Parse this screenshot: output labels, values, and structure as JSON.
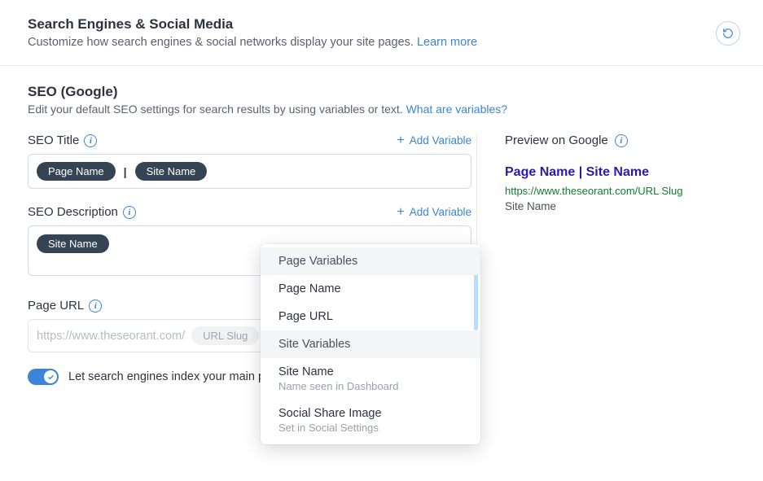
{
  "header": {
    "title": "Search Engines & Social Media",
    "subtitle_pre": "Customize how search engines & social networks display your site pages. ",
    "learn_more": "Learn more"
  },
  "seo": {
    "title": "SEO (Google)",
    "subtitle_pre": "Edit your default SEO settings for search results by using variables or text. ",
    "what_link": "What are variables?"
  },
  "fields": {
    "seo_title_label": "SEO Title",
    "seo_desc_label": "SEO Description",
    "page_url_label": "Page URL",
    "add_variable": "Add Variable",
    "title_pills": [
      "Page Name",
      "Site Name"
    ],
    "title_sep": "|",
    "desc_pills": [
      "Site Name"
    ],
    "url_base": "https://www.theseorant.com/",
    "url_slug": "URL Slug"
  },
  "toggle": {
    "label": "Let search engines index your main pages"
  },
  "preview": {
    "heading": "Preview on Google",
    "g_title": "Page Name | Site Name",
    "g_url": "https://www.theseorant.com/URL Slug",
    "g_desc": "Site Name"
  },
  "dropdown": {
    "items": [
      {
        "type": "header",
        "label": "Page Variables"
      },
      {
        "type": "item",
        "label": "Page Name"
      },
      {
        "type": "item",
        "label": "Page URL"
      },
      {
        "type": "header",
        "label": "Site Variables"
      },
      {
        "type": "item",
        "label": "Site Name",
        "sub": "Name seen in Dashboard"
      },
      {
        "type": "item",
        "label": "Social Share Image",
        "sub": "Set in Social Settings"
      }
    ]
  }
}
